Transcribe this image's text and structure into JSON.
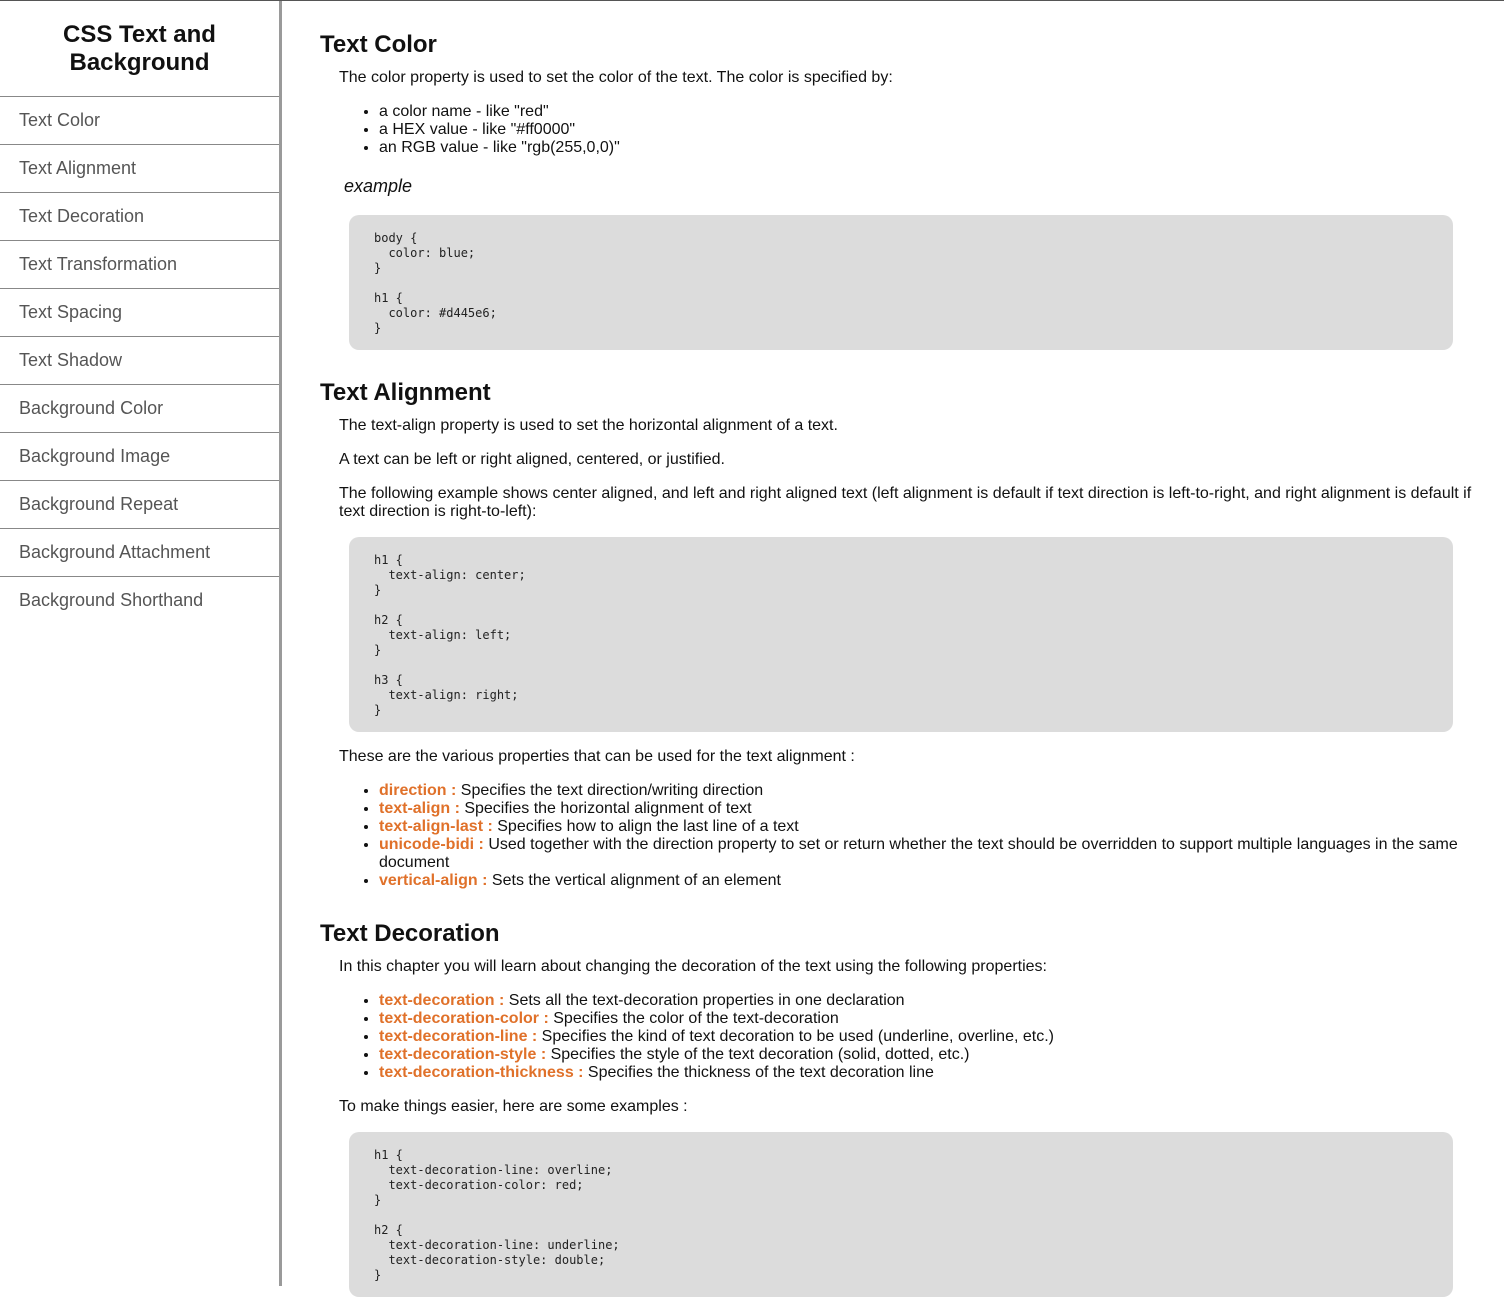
{
  "sidebar": {
    "title": "CSS Text and Background",
    "items": [
      {
        "label": "Text Color"
      },
      {
        "label": "Text Alignment"
      },
      {
        "label": "Text Decoration"
      },
      {
        "label": "Text Transformation"
      },
      {
        "label": "Text Spacing"
      },
      {
        "label": "Text Shadow"
      },
      {
        "label": "Background Color"
      },
      {
        "label": "Background Image"
      },
      {
        "label": "Background Repeat"
      },
      {
        "label": "Background Attachment"
      },
      {
        "label": "Background Shorthand"
      }
    ]
  },
  "text_color": {
    "heading": "Text Color",
    "intro": "The color property is used to set the color of the text. The color is specified by:",
    "bullets": [
      "a color name - like \"red\"",
      "a HEX value - like \"#ff0000\"",
      "an RGB value - like \"rgb(255,0,0)\""
    ],
    "example_label": "example",
    "code": "body {\n  color: blue;\n}\n\nh1 {\n  color: #d445e6;\n}"
  },
  "text_alignment": {
    "heading": "Text Alignment",
    "p1": "The text-align property is used to set the horizontal alignment of a text.",
    "p2": "A text can be left or right aligned, centered, or justified.",
    "p3": "The following example shows center aligned, and left and right aligned text (left alignment is default if text direction is left-to-right, and right alignment is default if text direction is right-to-left):",
    "code": "h1 {\n  text-align: center;\n}\n\nh2 {\n  text-align: left;\n}\n\nh3 {\n  text-align: right;\n}",
    "props_intro": "These are the various properties that can be used for the text alignment :",
    "props": [
      {
        "name": "direction :",
        "desc": " Specifies the text direction/writing direction"
      },
      {
        "name": "text-align :",
        "desc": " Specifies the horizontal alignment of text"
      },
      {
        "name": "text-align-last :",
        "desc": " Specifies how to align the last line of a text"
      },
      {
        "name": "unicode-bidi :",
        "desc": " Used together with the direction property to set or return whether the text should be overridden to support multiple languages in the same document"
      },
      {
        "name": "vertical-align :",
        "desc": " Sets the vertical alignment of an element"
      }
    ]
  },
  "text_decoration": {
    "heading": "Text Decoration",
    "intro": "In this chapter you will learn about changing the decoration of the text using the following properties:",
    "props": [
      {
        "name": "text-decoration :",
        "desc": " Sets all the text-decoration properties in one declaration"
      },
      {
        "name": "text-decoration-color :",
        "desc": " Specifies the color of the text-decoration"
      },
      {
        "name": "text-decoration-line :",
        "desc": " Specifies the kind of text decoration to be used (underline, overline, etc.)"
      },
      {
        "name": "text-decoration-style :",
        "desc": " Specifies the style of the text decoration (solid, dotted, etc.)"
      },
      {
        "name": "text-decoration-thickness :",
        "desc": " Specifies the thickness of the text decoration line"
      }
    ],
    "examples_intro": "To make things easier, here are some examples :",
    "code": "h1 {\n  text-decoration-line: overline;\n  text-decoration-color: red;\n}\n\nh2 {\n  text-decoration-line: underline;\n  text-decoration-style: double;\n}"
  }
}
